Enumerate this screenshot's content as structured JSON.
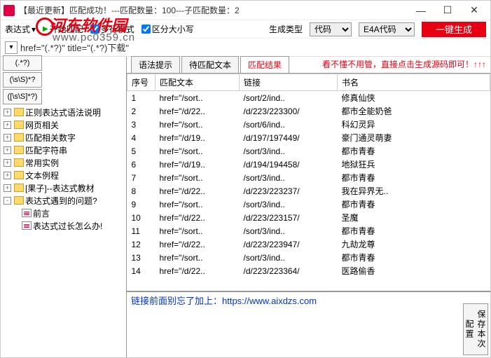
{
  "window": {
    "title": "【最近更新】匹配成功！---匹配数量：100---子匹配数量：2"
  },
  "toolbar": {
    "expr_label": "表达式",
    "start_match": "开始匹配",
    "multiline": "多行模式",
    "case_sensitive": "区分大小写",
    "gen_type_label": "生成类型",
    "select1": "代码",
    "select2": "E4A代码",
    "gen_btn": "一键生成"
  },
  "regex": {
    "text": "href=\"(.*?)\" title=\"(.*?)下载\""
  },
  "quick": {
    "b1": "(.*?)",
    "b2": "(\\s\\S)*?",
    "b3": "([\\s\\S]*?)"
  },
  "tree": {
    "items": [
      {
        "label": "正则表达式语法说明",
        "box": "+",
        "icon": "folder"
      },
      {
        "label": "网页相关",
        "box": "+",
        "icon": "folder"
      },
      {
        "label": "匹配相关数字",
        "box": "+",
        "icon": "folder"
      },
      {
        "label": "匹配字符串",
        "box": "+",
        "icon": "folder"
      },
      {
        "label": "常用实例",
        "box": "+",
        "icon": "folder"
      },
      {
        "label": "文本例程",
        "box": "+",
        "icon": "folder"
      },
      {
        "label": "[果子]--表达式教材",
        "box": "+",
        "icon": "folder"
      },
      {
        "label": "表达式遇到的问题?",
        "box": "-",
        "icon": "folder"
      }
    ],
    "children": [
      {
        "label": "前言"
      },
      {
        "label": "表达式过长怎么办!"
      }
    ]
  },
  "tabs": {
    "t1": "语法提示",
    "t2": "待匹配文本",
    "t3": "匹配结果",
    "hint": "看不懂不用管，直接点击生成源码即可！↑↑↑"
  },
  "headers": {
    "h0": "序号",
    "h1": "匹配文本",
    "h2": "链接",
    "h3": "书名"
  },
  "rows": [
    {
      "n": "1",
      "a": "href=\"/sort..",
      "b": "/sort/2/ind..",
      "c": "修真仙侠"
    },
    {
      "n": "2",
      "a": "href=\"/d/22..",
      "b": "/d/223/223300/",
      "c": "都市全能奶爸"
    },
    {
      "n": "3",
      "a": "href=\"/sort..",
      "b": "/sort/6/ind..",
      "c": "科幻灵异"
    },
    {
      "n": "4",
      "a": "href=\"/d/19..",
      "b": "/d/197/197449/",
      "c": "豪门通灵萌妻"
    },
    {
      "n": "5",
      "a": "href=\"/sort..",
      "b": "/sort/3/ind..",
      "c": "都市青春"
    },
    {
      "n": "6",
      "a": "href=\"/d/19..",
      "b": "/d/194/194458/",
      "c": "地狱狂兵"
    },
    {
      "n": "7",
      "a": "href=\"/sort..",
      "b": "/sort/3/ind..",
      "c": "都市青春"
    },
    {
      "n": "8",
      "a": "href=\"/d/22..",
      "b": "/d/223/223237/",
      "c": "我在异界无.."
    },
    {
      "n": "9",
      "a": "href=\"/sort..",
      "b": "/sort/3/ind..",
      "c": "都市青春"
    },
    {
      "n": "10",
      "a": "href=\"/d/22..",
      "b": "/d/223/223157/",
      "c": "圣魔"
    },
    {
      "n": "11",
      "a": "href=\"/sort..",
      "b": "/sort/3/ind..",
      "c": "都市青春"
    },
    {
      "n": "12",
      "a": "href=\"/d/22..",
      "b": "/d/223/223947/",
      "c": "九劫龙尊"
    },
    {
      "n": "13",
      "a": "href=\"/sort..",
      "b": "/sort/3/ind..",
      "c": "都市青春"
    },
    {
      "n": "14",
      "a": "href=\"/d/22..",
      "b": "/d/223/223364/",
      "c": "医路偷香"
    }
  ],
  "hint_line": "链接前面别忘了加上：https://www.aixdzs.com",
  "save_btn": "保存本次配置",
  "watermark": {
    "w1": "河东软件园",
    "w2": "www.pc0359.cn"
  }
}
